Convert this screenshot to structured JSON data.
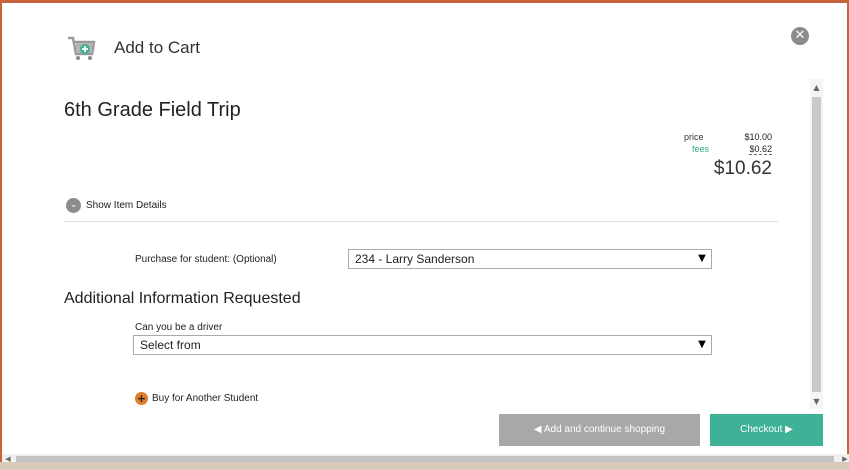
{
  "header": {
    "title": "Add to Cart",
    "icon": "cart-add-icon"
  },
  "item": {
    "title": "6th Grade Field Trip"
  },
  "pricing": {
    "price_label": "price",
    "price_value": "$10.00",
    "fees_label": "fees",
    "fees_value": "$0.62",
    "total": "$10.62"
  },
  "details_toggle": "Show Item Details",
  "student": {
    "label": "Purchase for student: (Optional)",
    "value": "234 - Larry Sanderson"
  },
  "additional": {
    "heading": "Additional Information Requested",
    "driver_label": "Can you be a driver",
    "driver_value": "Select from"
  },
  "buy_another": "Buy for Another Student",
  "buttons": {
    "continue": "◀ Add and continue shopping",
    "checkout": "Checkout ▶"
  },
  "colors": {
    "accent": "#3fb196",
    "fees": "#3aa88c",
    "plus": "#e07b2a",
    "border": "#c8623a"
  }
}
